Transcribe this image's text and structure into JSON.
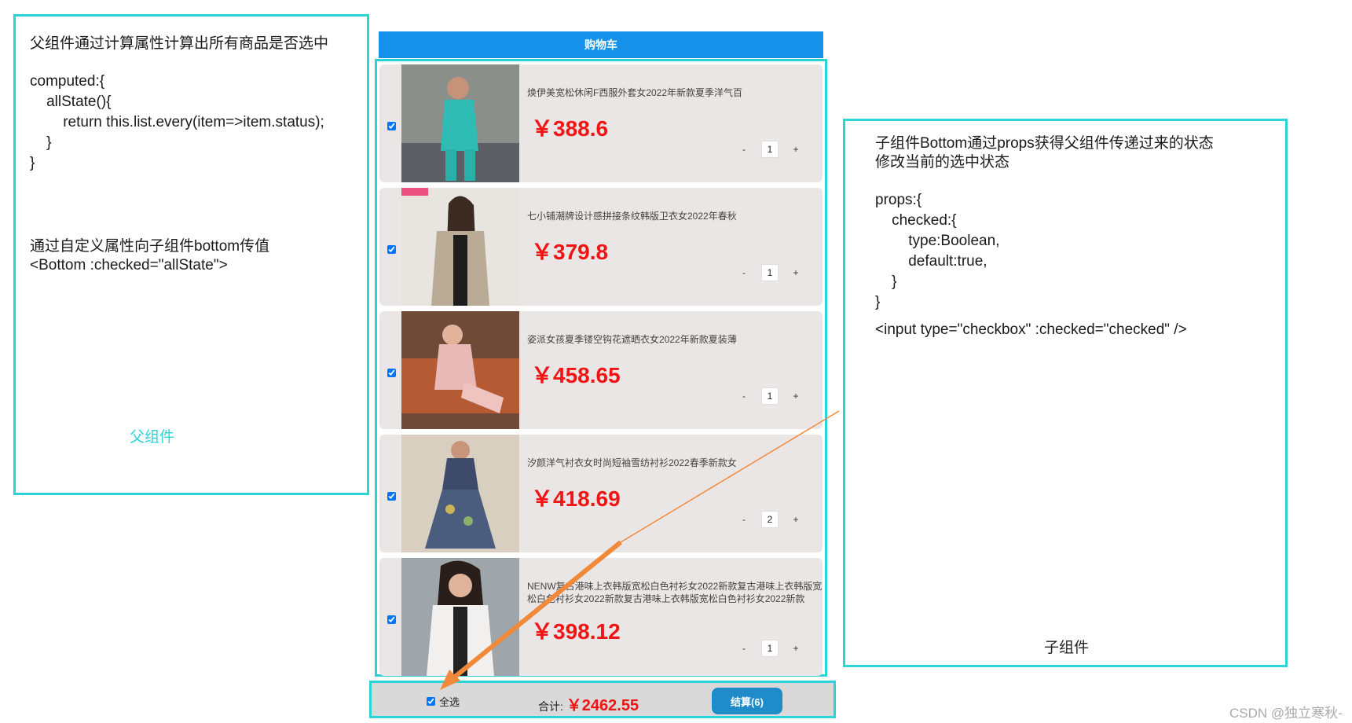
{
  "left_panel": {
    "heading": "父组件通过计算属性计算出所有商品是否选中",
    "code": "computed:{\n    allState(){\n        return this.list.every(item=>item.status);\n    }\n}",
    "note": "通过自定义属性向子组件bottom传值",
    "binding": "<Bottom :checked=\"allState\">",
    "caption": "父组件"
  },
  "right_panel": {
    "heading_line1": "子组件Bottom通过props获得父组件传递过来的状态",
    "heading_line2": "修改当前的选中状态",
    "code": "props:{\n    checked:{\n        type:Boolean,\n        default:true,\n    }\n}",
    "input": "<input type=\"checkbox\" :checked=\"checked\" />",
    "caption": "子组件"
  },
  "cart": {
    "title": "购物车",
    "items": [
      {
        "title": "焕伊美宽松休闲F西服外套女2022年新款夏季洋气百",
        "price": "￥388.6",
        "qty": "1",
        "checked": true
      },
      {
        "title": "七小铺潮牌设计感拼接条纹韩版卫衣女2022年春秋",
        "price": "￥379.8",
        "qty": "1",
        "checked": true
      },
      {
        "title": "姿派女孩夏季镂空钩花遮晒衣女2022年新款夏装薄",
        "price": "￥458.65",
        "qty": "1",
        "checked": true
      },
      {
        "title": "汐颜洋气衬衣女时尚短袖雪纺衬衫2022春季新款女",
        "price": "￥418.69",
        "qty": "2",
        "checked": true
      },
      {
        "title": "NENW复古港味上衣韩版宽松白色衬衫女2022新款复古港味上衣韩版宽松白色衬衫女2022新款复古港味上衣韩版宽松白色衬衫女2022新款",
        "price": "￥398.12",
        "qty": "1",
        "checked": true
      }
    ],
    "minus": "-",
    "plus": "+",
    "footer": {
      "select_all": "全选",
      "total_label": "合计:",
      "total_value": "￥2462.55",
      "checkout": "结算(6)"
    }
  },
  "watermark": "CSDN @独立寒秋-",
  "colors": {
    "accent": "#2ad4d6",
    "header": "#1691e9",
    "price": "#f01414",
    "arrow": "#f0893a",
    "checkout": "#1f8bc9"
  }
}
